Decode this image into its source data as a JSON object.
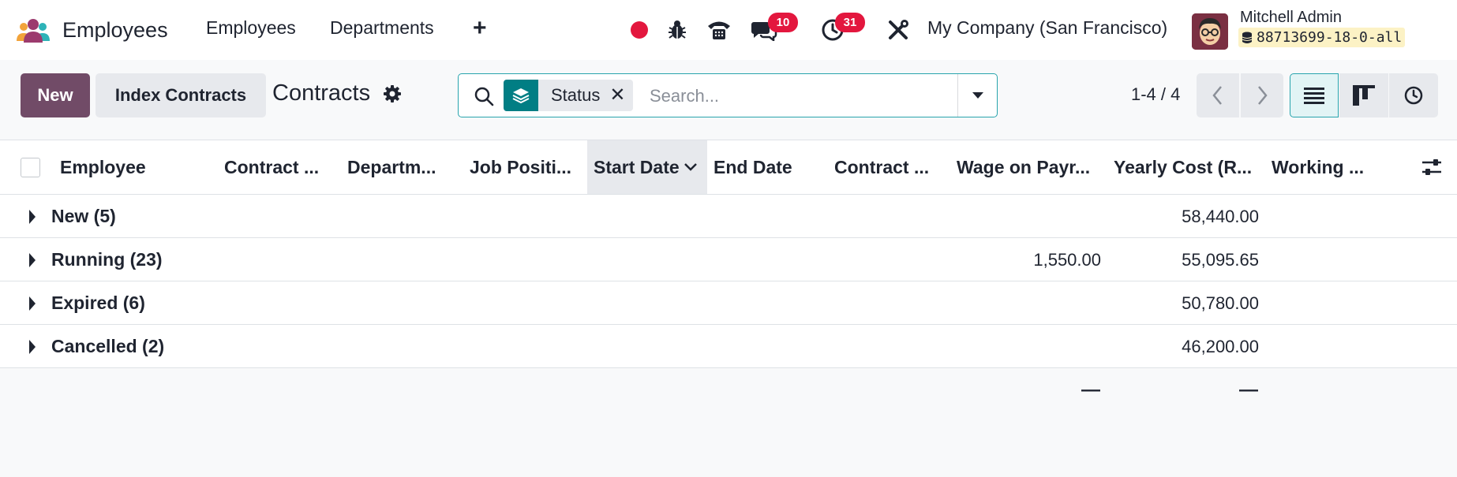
{
  "navbar": {
    "app_title": "Employees",
    "menu": [
      "Employees",
      "Departments"
    ],
    "new_menu_icon": "plus-icon",
    "systray": {
      "record_icon": "record-dot-icon",
      "debug_icon": "bug-icon",
      "phone_icon": "phone-icon",
      "messages_badge": "10",
      "activities_badge": "31",
      "tools_icon": "tools-icon"
    },
    "company": "My Company (San Francisco)",
    "user_name": "Mitchell Admin",
    "database": "88713699-18-0-all"
  },
  "control_panel": {
    "new_label": "New",
    "index_label": "Index Contracts",
    "title": "Contracts",
    "search": {
      "facet_label": "Status",
      "placeholder": "Search..."
    },
    "pager": "1-4 / 4",
    "views": [
      "list-view-icon",
      "kanban-view-icon",
      "activity-view-icon"
    ],
    "active_view": "list"
  },
  "table": {
    "columns": [
      "Employee",
      "Contract ...",
      "Departm...",
      "Job Positi...",
      "Start Date",
      "End Date",
      "Contract ...",
      "Wage on Payr...",
      "Yearly Cost (R...",
      "Working ..."
    ],
    "sorted_column": "Start Date",
    "groups": [
      {
        "label": "New (5)",
        "wage": "",
        "yearly_cost": "58,440.00"
      },
      {
        "label": "Running (23)",
        "wage": "1,550.00",
        "yearly_cost": "55,095.65"
      },
      {
        "label": "Expired (6)",
        "wage": "",
        "yearly_cost": "50,780.00"
      },
      {
        "label": "Cancelled (2)",
        "wage": "",
        "yearly_cost": "46,200.00"
      }
    ],
    "totals": {
      "wage": "—",
      "yearly_cost": "—"
    }
  },
  "colors": {
    "primary": "#714b67",
    "accent": "#017e84",
    "badge": "#e3173e",
    "record": "#e3173e"
  }
}
